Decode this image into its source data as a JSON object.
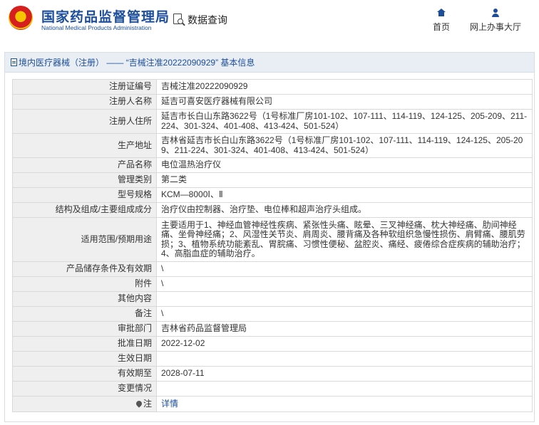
{
  "header": {
    "site_title": "国家药品监督管理局",
    "site_subtitle": "National Medical Products Administration",
    "search_label": "数据查询",
    "nav": [
      {
        "label": "首页",
        "icon": "home-icon"
      },
      {
        "label": "网上办事大厅",
        "icon": "user-icon"
      }
    ]
  },
  "panel": {
    "title": "境内医疗器械（注册） —— “吉械注准20222090929” 基本信息"
  },
  "rows": [
    {
      "label": "注册证编号",
      "value": "吉械注准20222090929"
    },
    {
      "label": "注册人名称",
      "value": "延吉可喜安医疗器械有限公司"
    },
    {
      "label": "注册人住所",
      "value": "延吉市长白山东路3622号（1号标准厂房101-102、107-111、114-119、124-125、205-209、211-224、301-324、401-408、413-424、501-524）"
    },
    {
      "label": "生产地址",
      "value": "吉林省延吉市长白山东路3622号（1号标准厂房101-102、107-111、114-119、124-125、205-209、211-224、301-324、401-408、413-424、501-524）"
    },
    {
      "label": "产品名称",
      "value": "电位温热治疗仪"
    },
    {
      "label": "管理类别",
      "value": "第二类"
    },
    {
      "label": "型号规格",
      "value": "KCM—8000Ⅰ、Ⅱ"
    },
    {
      "label": "结构及组成/主要组成成分",
      "value": "治疗仪由控制器、治疗垫、电位棒和超声治疗头组成。"
    },
    {
      "label": "适用范围/预期用途",
      "value": "主要适用于1、神经血管神经性疾病、紧张性头痛、眩晕、三叉神经痛、枕大神经痛、肋间神经痛、坐骨神经痛；2、风湿性关节炎、肩周炎、腰背痛及各种软组织急慢性损伤、肩臂痛、腰肌劳损；3、植物系统功能紊乱、胃脘痛、习惯性便秘、盆腔炎、痛经、疲倦综合症疾病的辅助治疗；4、高脂血症的辅助治疗。"
    },
    {
      "label": "产品储存条件及有效期",
      "value": "\\"
    },
    {
      "label": "附件",
      "value": "\\"
    },
    {
      "label": "其他内容",
      "value": ""
    },
    {
      "label": "备注",
      "value": "\\"
    },
    {
      "label": "审批部门",
      "value": "吉林省药品监督管理局"
    },
    {
      "label": "批准日期",
      "value": "2022-12-02"
    },
    {
      "label": "生效日期",
      "value": ""
    },
    {
      "label": "有效期至",
      "value": "2028-07-11"
    },
    {
      "label": "变更情况",
      "value": ""
    },
    {
      "label": "注",
      "value": "详情"
    }
  ]
}
